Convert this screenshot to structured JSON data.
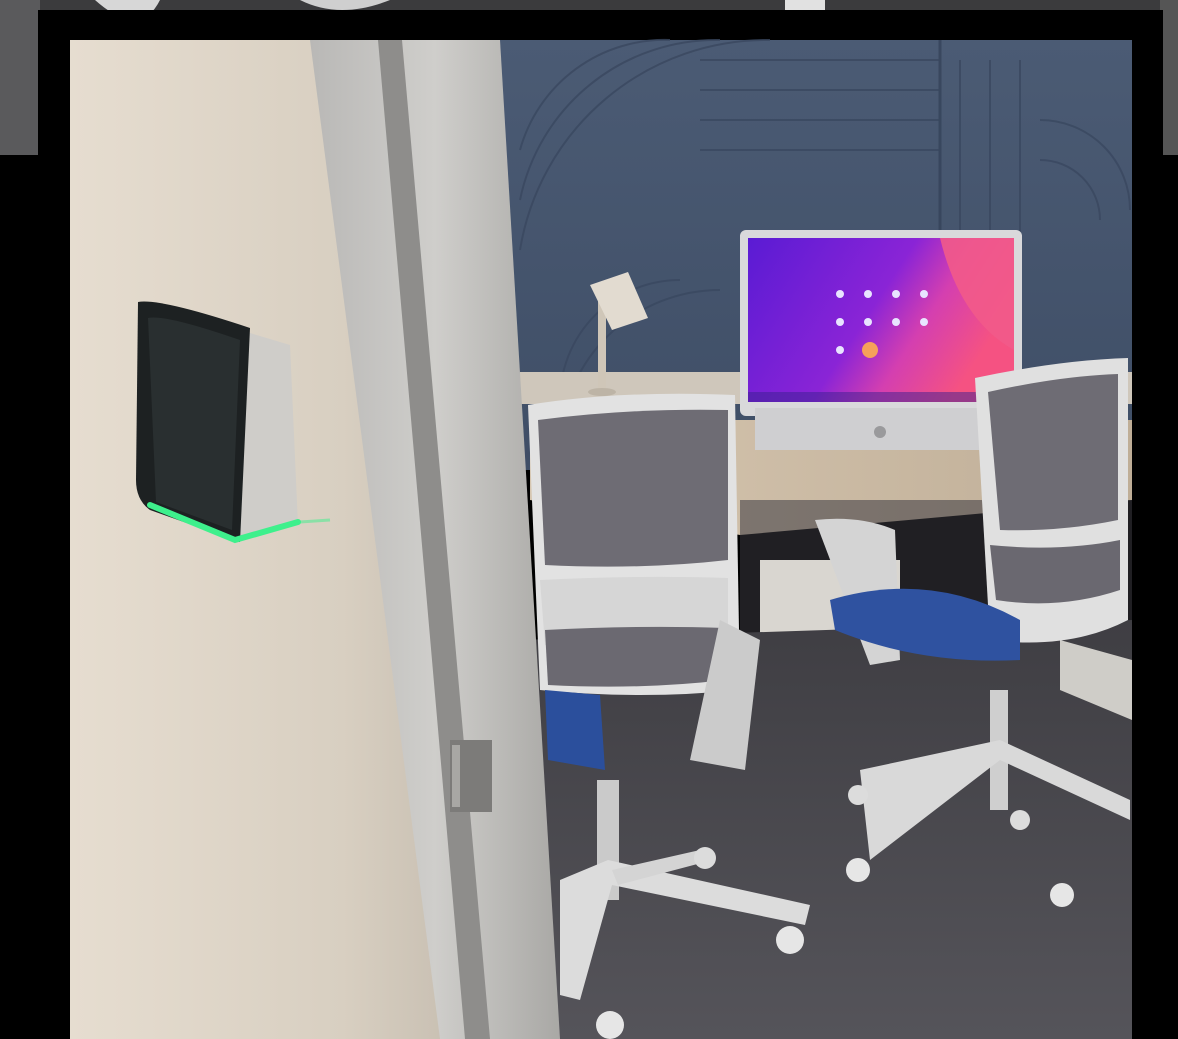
{
  "photo": {
    "subject": "huddle-room",
    "accent_colors": {
      "frame": "#000000",
      "wall": "#d9d1c4",
      "acoustic_panel": "#4a5a72",
      "desk": "#c9b9a3",
      "screen_purple": "#7a1fd8",
      "screen_pink": "#ef4c8f",
      "led_green": "#3ef08c",
      "chair_shell": "#dcdcdc",
      "chair_mesh": "#6c6a72",
      "seat_blue": "#2c4f9b",
      "carpet": "#4b4a4e"
    }
  }
}
